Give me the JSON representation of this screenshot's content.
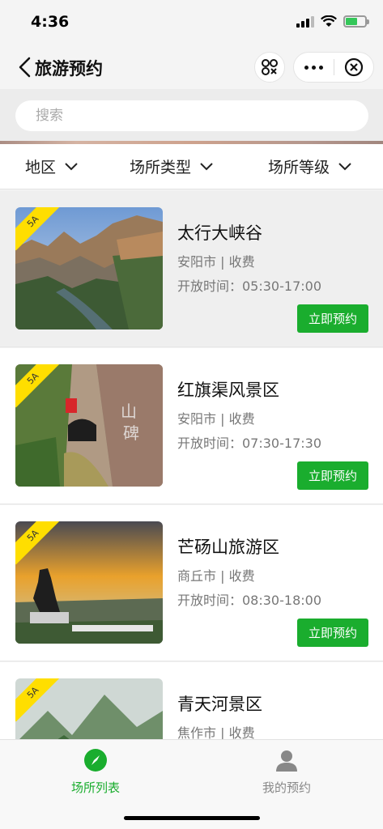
{
  "status_bar": {
    "time": "4:36"
  },
  "nav": {
    "title": "旅游预约"
  },
  "search": {
    "placeholder": "搜索"
  },
  "filters": [
    {
      "label": "地区"
    },
    {
      "label": "场所类型"
    },
    {
      "label": "场所等级"
    }
  ],
  "venues": [
    {
      "name": "太行大峡谷",
      "meta": "安阳市 | 收费",
      "hours": "开放时间：05:30-17:00",
      "level": "5A",
      "button": "立即预约"
    },
    {
      "name": "红旗渠风景区",
      "meta": "安阳市 | 收费",
      "hours": "开放时间：07:30-17:30",
      "level": "5A",
      "button": "立即预约"
    },
    {
      "name": "芒砀山旅游区",
      "meta": "商丘市 | 收费",
      "hours": "开放时间：08:30-18:00",
      "level": "5A",
      "button": "立即预约"
    },
    {
      "name": "青天河景区",
      "meta": "焦作市 | 收费",
      "hours": "",
      "level": "5A",
      "button": ""
    }
  ],
  "tabs": [
    {
      "label": "场所列表",
      "icon": "compass-icon",
      "active": true
    },
    {
      "label": "我的预约",
      "icon": "person-icon",
      "active": false
    }
  ],
  "colors": {
    "accent": "#1aad2e",
    "tag": "#ffde00",
    "inactive": "#888888"
  }
}
